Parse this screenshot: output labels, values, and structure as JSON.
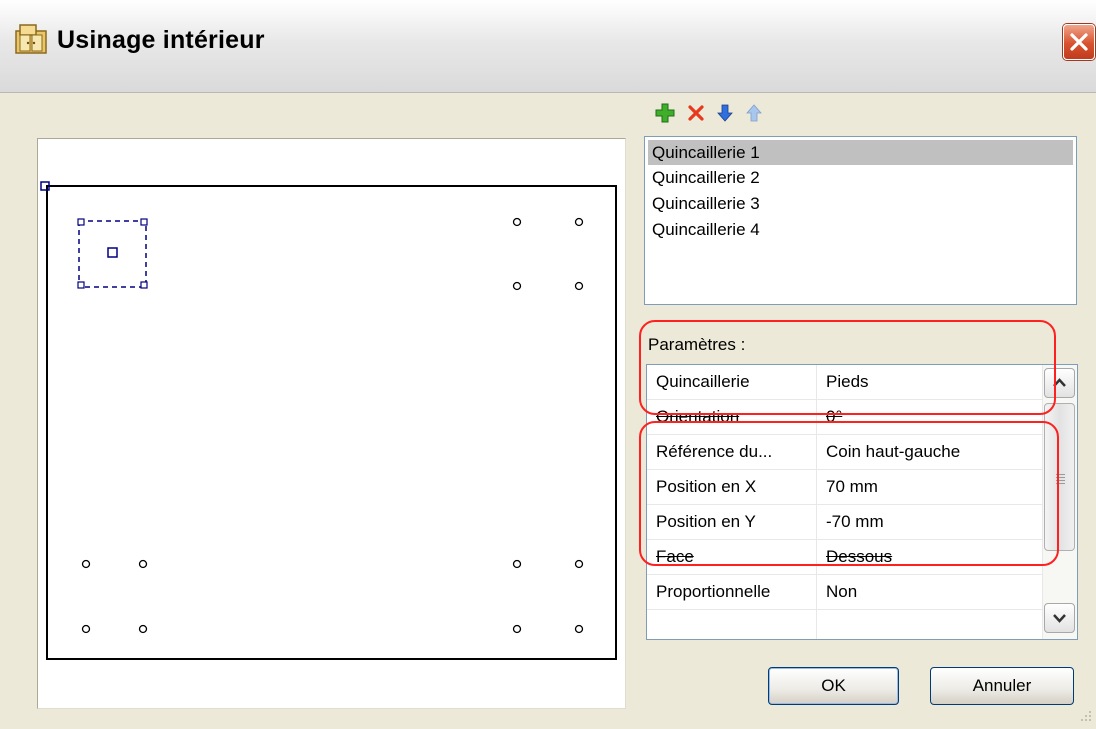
{
  "window": {
    "title": "Usinage intérieur",
    "app_icon": "cabinet-icon",
    "close_icon": "close-icon"
  },
  "toolbar": {
    "add_icon": "green-plus-icon",
    "delete_icon": "red-x-icon",
    "move_down_icon": "blue-arrow-down-icon",
    "move_up_icon": "arrow-up-disabled-icon"
  },
  "hardware_list": {
    "items": [
      "Quincaillerie 1",
      "Quincaillerie 2",
      "Quincaillerie 3",
      "Quincaillerie 4"
    ],
    "selected_index": 0,
    "selected_color": "#c0c0c0"
  },
  "parameters": {
    "label": "Paramètres :",
    "rows": [
      {
        "name": "Quincaillerie",
        "value": "Pieds"
      },
      {
        "name": "Orientation",
        "value": "0°"
      },
      {
        "name": "Référence du...",
        "value": "Coin haut-gauche"
      },
      {
        "name": "Position en X",
        "value": "70 mm"
      },
      {
        "name": "Position en Y",
        "value": "-70 mm"
      },
      {
        "name": "Face",
        "value": "Dessous"
      },
      {
        "name": "Proportionnelle",
        "value": "Non"
      },
      {
        "name": "",
        "value": ""
      }
    ],
    "annotation_color": "#ff2020"
  },
  "buttons": {
    "ok": "OK",
    "cancel": "Annuler"
  },
  "colors": {
    "dialog_bg": "#ece9d8",
    "selection_marker": "#000080",
    "close_button": "#d7522f"
  }
}
